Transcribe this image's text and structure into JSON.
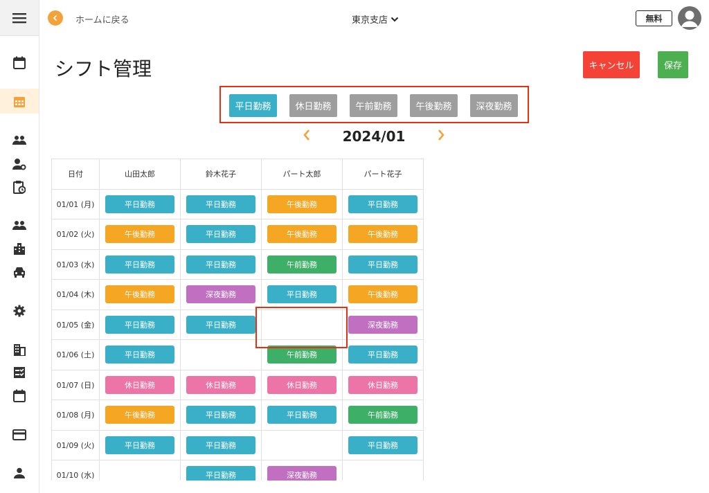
{
  "header": {
    "back_label": "ホームに戻る",
    "branch": "東京支店",
    "plan_badge": "無料"
  },
  "page": {
    "title": "シフト管理",
    "cancel_label": "キャンセル",
    "save_label": "保存"
  },
  "shift_types": [
    {
      "label": "平日勤務",
      "color": "#3ab0c8",
      "selected": true
    },
    {
      "label": "休日勤務",
      "color": "#9e9e9e"
    },
    {
      "label": "午前勤務",
      "color": "#9e9e9e"
    },
    {
      "label": "午後勤務",
      "color": "#9e9e9e"
    },
    {
      "label": "深夜勤務",
      "color": "#9e9e9e"
    }
  ],
  "month": "2024/01",
  "table": {
    "headers": [
      "日付",
      "山田太郎",
      "鈴木花子",
      "パート太郎",
      "パート花子"
    ],
    "rows": [
      {
        "date": "01/01 (月)",
        "shifts": [
          "平日勤務",
          "平日勤務",
          "午後勤務",
          "平日勤務"
        ]
      },
      {
        "date": "01/02 (火)",
        "shifts": [
          "午後勤務",
          "平日勤務",
          "午後勤務",
          "午後勤務"
        ]
      },
      {
        "date": "01/03 (水)",
        "shifts": [
          "平日勤務",
          "平日勤務",
          "午前勤務",
          "平日勤務"
        ]
      },
      {
        "date": "01/04 (木)",
        "shifts": [
          "午後勤務",
          "深夜勤務",
          "平日勤務",
          "午後勤務"
        ]
      },
      {
        "date": "01/05 (金)",
        "shifts": [
          "平日勤務",
          "平日勤務",
          "",
          "深夜勤務"
        ]
      },
      {
        "date": "01/06 (土)",
        "shifts": [
          "平日勤務",
          "",
          "午前勤務",
          "平日勤務"
        ]
      },
      {
        "date": "01/07 (日)",
        "shifts": [
          "休日勤務",
          "休日勤務",
          "休日勤務",
          "休日勤務"
        ]
      },
      {
        "date": "01/08 (月)",
        "shifts": [
          "午後勤務",
          "平日勤務",
          "平日勤務",
          "午前勤務"
        ]
      },
      {
        "date": "01/09 (火)",
        "shifts": [
          "平日勤務",
          "平日勤務",
          "",
          "平日勤務"
        ]
      },
      {
        "date": "01/10 (水)",
        "shifts": [
          "",
          "平日勤務",
          "深夜勤務",
          ""
        ]
      }
    ]
  },
  "shift_colors": {
    "平日勤務": "#3ab0c8",
    "休日勤務": "#ec74a6",
    "午前勤務": "#3daf66",
    "午後勤務": "#f5a623",
    "深夜勤務": "#c06fc1"
  },
  "icons": {
    "sidebar": [
      "menu-icon",
      "calendar-icon",
      "calendar-grid-icon",
      "people-icon",
      "user-settings-icon",
      "clipboard-clock-icon",
      "people-icon",
      "apartment-icon",
      "car-icon",
      "gear-icon",
      "business-icon",
      "checklist-icon",
      "calendar-icon",
      "credit-card-icon",
      "person-icon"
    ]
  }
}
